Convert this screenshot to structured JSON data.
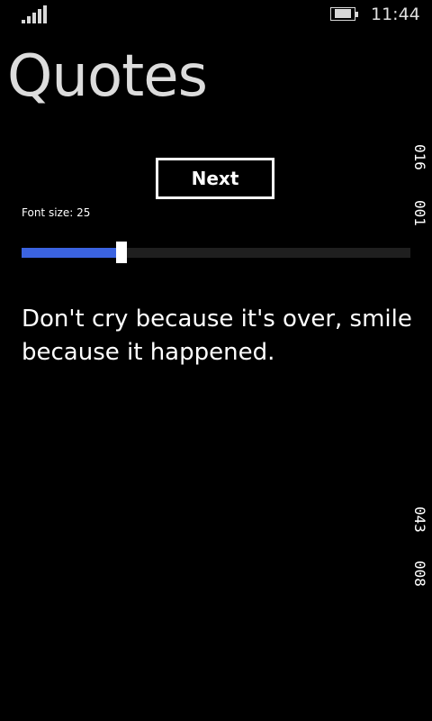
{
  "status": {
    "time": "11:44",
    "signal_icon": "signal-strength-icon",
    "battery_icon": "battery-charging-icon"
  },
  "page": {
    "title": "Quotes"
  },
  "controls": {
    "next_label": "Next",
    "font_size_label": "Font size: 25",
    "slider": {
      "min": 0,
      "max": 100,
      "value": 25,
      "fill_color": "#3b63e0"
    }
  },
  "quote": {
    "text": "Don't cry because it's over, smile because it happened."
  },
  "side_counters": [
    "016",
    "001",
    "043",
    "008"
  ]
}
